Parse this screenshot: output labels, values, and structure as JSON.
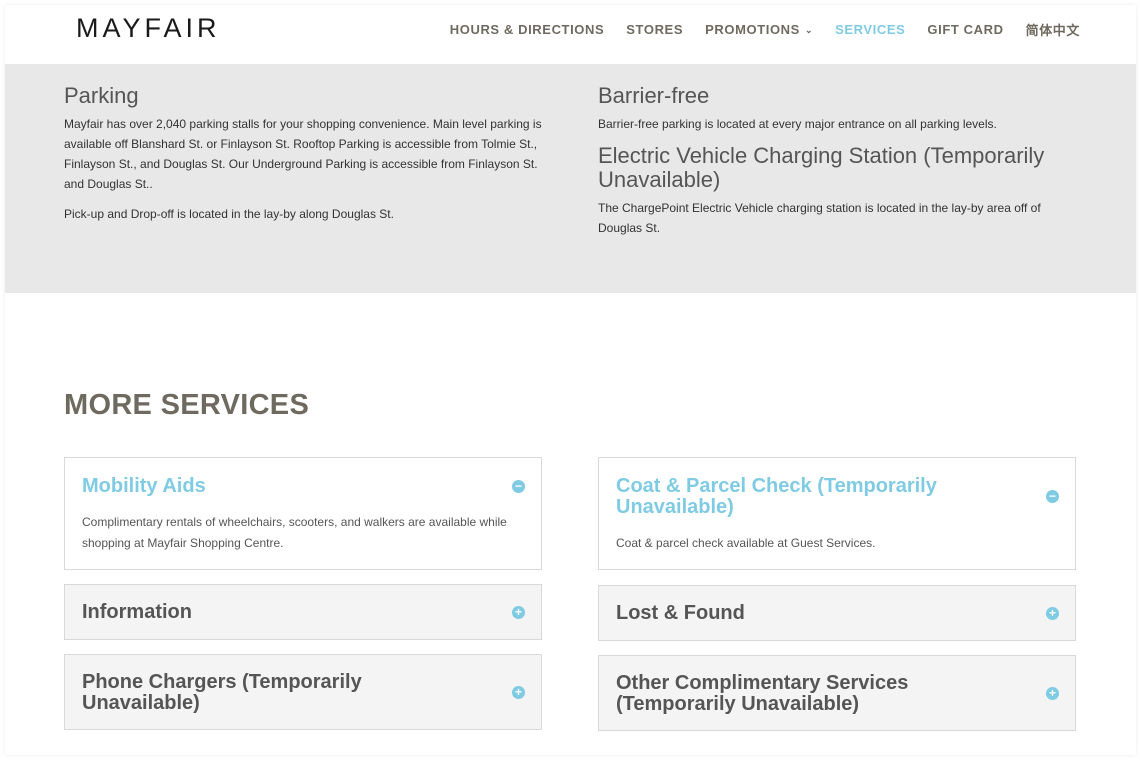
{
  "header": {
    "logo": "MAYFAIR",
    "nav": [
      {
        "label": "HOURS & DIRECTIONS"
      },
      {
        "label": "STORES"
      },
      {
        "label": "PROMOTIONS"
      },
      {
        "label": "SERVICES"
      },
      {
        "label": "GIFT CARD"
      },
      {
        "label": "简体中文"
      }
    ],
    "chevron": "⌄"
  },
  "parking": {
    "left": {
      "title": "Parking",
      "p1": "Mayfair has over 2,040 parking stalls for your shopping convenience. Main level parking is available off Blanshard St. or Finlayson St. Rooftop Parking is accessible from Tolmie St., Finlayson St., and Douglas St. Our Underground Parking is accessible from Finlayson St. and Douglas St..",
      "p2": "Pick-up and Drop-off is located in the lay-by along Douglas St."
    },
    "right": {
      "title1": "Barrier-free",
      "p1": "Barrier-free parking is located at every major entrance on all parking levels.",
      "title2": "Electric Vehicle Charging Station (Temporarily Unavailable)",
      "p2": "The ChargePoint Electric Vehicle charging station is located in the lay-by area off of Douglas St."
    }
  },
  "more_services": {
    "title_light": "MORE ",
    "title_bold": "SERVICES",
    "accordions": [
      {
        "title": "Mobility Aids",
        "body": "Complimentary rentals of wheelchairs, scooters, and walkers are available while shopping at Mayfair Shopping Centre.",
        "toggle": "−"
      },
      {
        "title": "Coat & Parcel Check (Temporarily Unavailable)",
        "body": "Coat & parcel check available at Guest Services.",
        "toggle": "−"
      },
      {
        "title": "Information",
        "toggle": "+"
      },
      {
        "title": "Lost & Found",
        "toggle": "+"
      },
      {
        "title": "Phone Chargers (Temporarily Unavailable)",
        "toggle": "+"
      },
      {
        "title": "Other Complimentary Services (Temporarily Unavailable)",
        "toggle": "+"
      }
    ]
  },
  "colors": {
    "accent": "#7fcbe4",
    "nav_text": "#6f6a5f",
    "band_bg": "#e8e8e8"
  }
}
